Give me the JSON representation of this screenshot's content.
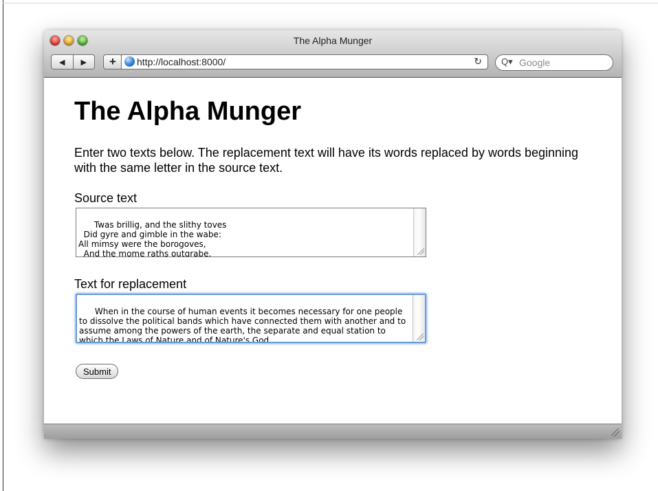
{
  "window": {
    "title": "The Alpha Munger"
  },
  "toolbar": {
    "back_glyph": "◀",
    "forward_glyph": "▶",
    "add_glyph": "+",
    "url": "http://localhost:8000/",
    "reload_glyph": "↻",
    "search_icon": "Q▾",
    "search_placeholder": "Google"
  },
  "page": {
    "heading": "The Alpha Munger",
    "intro": "Enter two texts below. The replacement text will have its words replaced by words beginning with the same letter in the source text.",
    "source_label": "Source text",
    "source_value": "Twas brillig, and the slithy toves\n  Did gyre and gimble in the wabe:\nAll mimsy were the borogoves,\n  And the mome raths outgrabe.",
    "replacement_label": "Text for replacement",
    "replacement_value": "When in the course of human events it becomes necessary for one people to dissolve the political bands which have connected them with another and to assume among the powers of the earth, the separate and equal station to which the Laws of Nature and of Nature's God",
    "submit_label": "Submit"
  },
  "colors": {
    "focus_ring": "#6b9ad8",
    "close": "#e0322b",
    "minimize": "#e0a326",
    "zoom": "#4aa82b"
  }
}
